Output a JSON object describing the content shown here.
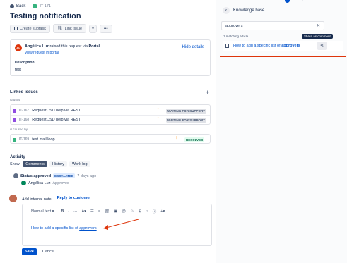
{
  "nav": {
    "back": "Back",
    "issue_key": "IT-171"
  },
  "title": "Testing notification",
  "toolbar": {
    "create_subtask": "Create subtask",
    "link_issue": "Link issue",
    "more": "•••"
  },
  "request": {
    "avatar_initials": "AL",
    "author": "Angélica Luz",
    "raised_text": "raised this request via",
    "channel": "Portal",
    "view_link": "View request in portal",
    "hide_details": "Hide details",
    "description_label": "Description",
    "description": "test"
  },
  "linked": {
    "title": "Linked issues",
    "add": "+",
    "causes_label": "causes",
    "caused_by_label": "is caused by",
    "causes": [
      {
        "key": "IT-167",
        "summary": "Request JSD help via REST",
        "status": "WAITING FOR SUPPORT"
      },
      {
        "key": "IT-168",
        "summary": "Request JSD help via REST",
        "status": "WAITING FOR SUPPORT"
      }
    ],
    "caused_by": [
      {
        "key": "IT-169",
        "summary": "test mail loop",
        "status": "RESOLVED"
      }
    ]
  },
  "activity": {
    "title": "Activity",
    "show_label": "Show:",
    "filters": [
      "Comments",
      "History",
      "Work log"
    ],
    "entry": {
      "status_text": "Status approved",
      "badge": "ESCALATED",
      "time": "7 days ago",
      "user": "Angélica Luz",
      "action": "Approved"
    }
  },
  "comment": {
    "tabs": [
      "Add internal note",
      "Reply to customer"
    ],
    "editor": {
      "text_style": "Normal text",
      "bold": "B",
      "italic": "I",
      "more": "···",
      "color": "A"
    },
    "body_text": "How to add a specific list of",
    "body_link": "approvers",
    "save": "Save",
    "cancel": "Cancel"
  },
  "kb": {
    "title": "Knowledge base",
    "search_value": "approvers",
    "match_count": "1 matching article",
    "tooltip": "Share as comment",
    "article_prefix": "How to add a specific list of",
    "article_highlight": "approvers"
  },
  "colors": {
    "accent": "#0052cc",
    "arrow": "#de350b",
    "highlight_border": "#de350b",
    "resolved": "#006644"
  }
}
